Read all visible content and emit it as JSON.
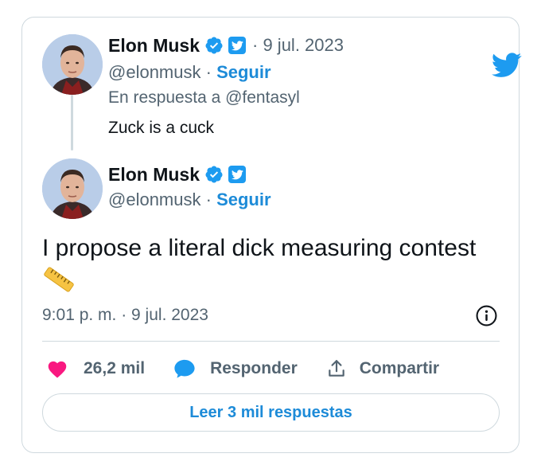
{
  "colors": {
    "accent": "#1d9bf0",
    "link": "#1d8bd8",
    "secondary_text": "#536471",
    "like": "#f91880",
    "border": "#cfd9de"
  },
  "reply_tweet": {
    "author_name": "Elon Musk",
    "date": "· 9 jul. 2023",
    "handle": "@elonmusk",
    "separator": "·",
    "follow_label": "Seguir",
    "in_reply_to": "En respuesta a @fentasyl",
    "text": "Zuck is a cuck"
  },
  "main_tweet": {
    "author_name": "Elon Musk",
    "handle": "@elonmusk",
    "separator": "·",
    "follow_label": "Seguir",
    "text": "I propose a literal dick measuring contest",
    "emoji_icon": "ruler-icon",
    "timestamp": "9:01 p. m. · 9 jul. 2023"
  },
  "actions": {
    "likes": "26,2 mil",
    "reply_label": "Responder",
    "share_label": "Compartir"
  },
  "read_replies_label": "Leer 3 mil respuestas",
  "icons": [
    "twitter-bird-icon",
    "verified-badge-icon",
    "twitter-badge-icon",
    "info-icon",
    "heart-icon",
    "reply-bubble-icon",
    "share-icon",
    "ruler-icon"
  ]
}
